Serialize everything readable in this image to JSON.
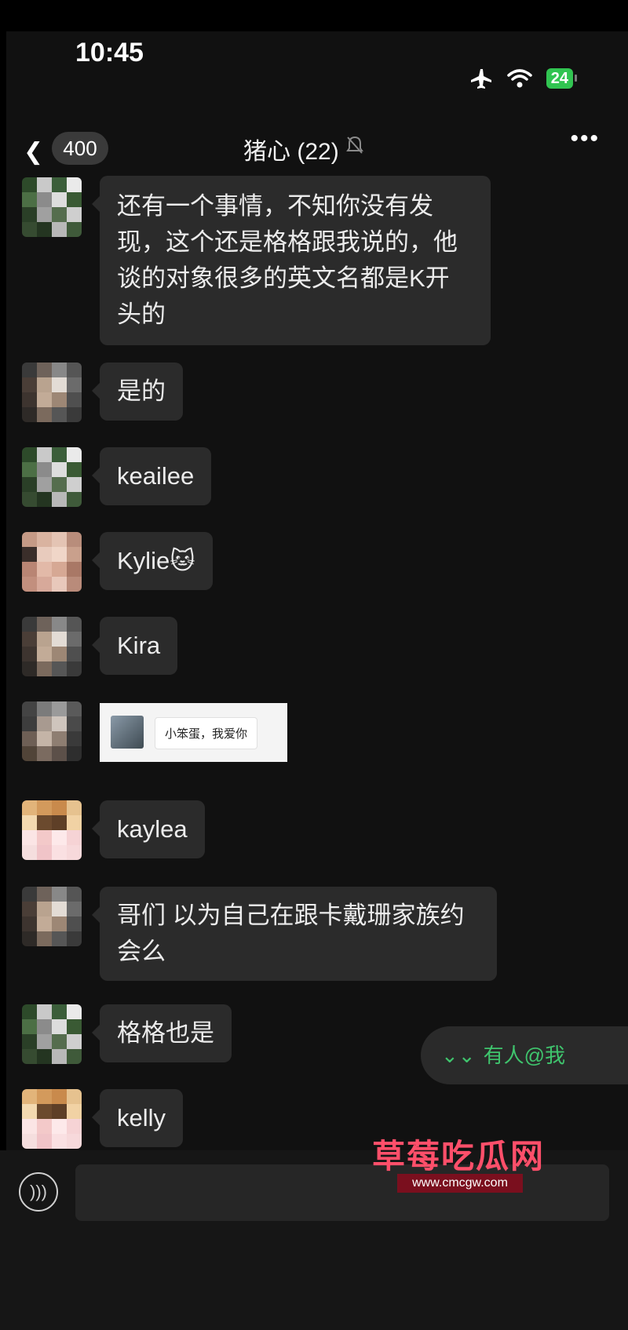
{
  "status": {
    "time": "10:45",
    "battery": "24"
  },
  "header": {
    "back_count": "400",
    "title": "猪心 (22)",
    "more": "•••"
  },
  "messages": [
    {
      "text": "还有一个事情，不知你没有发现，这个还是格格跟我说的，他谈的对象很多的英文名都是K开头的"
    },
    {
      "text": "是的"
    },
    {
      "text": "keailee"
    },
    {
      "text": "Kylie🐱"
    },
    {
      "text": "Kira"
    },
    {
      "image_caption": "小笨蛋，我爱你"
    },
    {
      "text": "kaylea"
    },
    {
      "text": "哥们 以为自己在跟卡戴珊家族约会么"
    },
    {
      "text": "格格也是"
    },
    {
      "text": "kelly"
    }
  ],
  "mention": {
    "label": "有人@我",
    "arrow": "⌄⌄"
  },
  "watermark": {
    "title": "草莓吃瓜网",
    "url": "www.cmcgw.com"
  },
  "colors": {
    "bubble": "#2b2b2b",
    "background": "#111111",
    "mention": "#3fc46d",
    "battery": "#31c451"
  }
}
